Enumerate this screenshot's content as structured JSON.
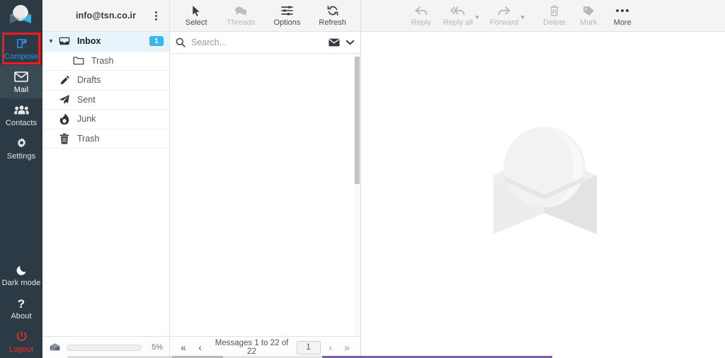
{
  "app": {
    "name": "Roundcube Webmail",
    "logo_icon": "roundcube-cube-logo"
  },
  "taskbar": {
    "items": [
      {
        "label": "Compose",
        "icon": "compose-pencil-square-icon",
        "state": "highlighted",
        "color": "#2c96e8",
        "highlight_color": "#ee1d1d"
      },
      {
        "label": "Mail",
        "icon": "envelope-icon",
        "state": "active"
      },
      {
        "label": "Contacts",
        "icon": "users-group-icon",
        "state": "normal"
      },
      {
        "label": "Settings",
        "icon": "gear-icon",
        "state": "normal"
      }
    ],
    "bottom_items": [
      {
        "label": "Dark mode",
        "icon": "moon-icon",
        "state": "normal"
      },
      {
        "label": "About",
        "icon": "question-mark-icon",
        "state": "normal"
      },
      {
        "label": "Logout",
        "icon": "power-off-icon",
        "state": "normal",
        "color": "#e03b35"
      }
    ],
    "background_color": "#2b3a44"
  },
  "folders": {
    "account": {
      "email": "info@tsn.co.ir",
      "menu_icon": "kebab-menu-icon"
    },
    "items": [
      {
        "name": "Inbox",
        "icon": "inbox-icon",
        "selected": true,
        "expanded": true,
        "child": false,
        "badge": "1",
        "chevron": "chevron-down-icon"
      },
      {
        "name": "Trash",
        "icon": "folder-icon",
        "selected": false,
        "child": true,
        "badge": ""
      },
      {
        "name": "Drafts",
        "icon": "pencil-icon",
        "selected": false,
        "child": false,
        "badge": ""
      },
      {
        "name": "Sent",
        "icon": "paper-plane-icon",
        "selected": false,
        "child": false,
        "badge": ""
      },
      {
        "name": "Junk",
        "icon": "fire-icon",
        "selected": false,
        "child": false,
        "badge": ""
      },
      {
        "name": "Trash",
        "icon": "trash-can-icon",
        "selected": false,
        "child": false,
        "badge": ""
      }
    ],
    "quota": {
      "icon": "database-disk-icon",
      "percent_label": "5%",
      "percent_value": 5,
      "fill_color": "#39b5f0"
    }
  },
  "list_toolbar": {
    "buttons": [
      {
        "label": "Select",
        "icon": "cursor-arrow-icon",
        "disabled": false
      },
      {
        "label": "Threads",
        "icon": "speech-bubbles-icon",
        "disabled": true
      },
      {
        "label": "Options",
        "icon": "sliders-options-icon",
        "disabled": false
      },
      {
        "label": "Refresh",
        "icon": "refresh-arrows-icon",
        "disabled": false
      }
    ]
  },
  "search": {
    "placeholder": "Search...",
    "value": "",
    "icon": "search-magnifier-icon",
    "scope_icon": "envelope-icon",
    "dropdown_icon": "chevron-down-icon"
  },
  "message_list": {
    "rows": [],
    "empty": true,
    "scrollbar": {
      "visible": true
    }
  },
  "pager": {
    "first_icon": "double-chevron-left-icon",
    "prev_icon": "chevron-left-icon",
    "count_label": "Messages 1 to 22 of 22",
    "page_value": "1",
    "next_icon": "chevron-right-icon",
    "last_icon": "double-chevron-right-icon"
  },
  "content_toolbar": {
    "buttons": [
      {
        "label": "Reply",
        "icon": "reply-arrow-icon",
        "disabled": true,
        "has_caret": false
      },
      {
        "label": "Reply all",
        "icon": "reply-all-arrows-icon",
        "disabled": true,
        "has_caret": true
      },
      {
        "label": "Forward",
        "icon": "forward-arrow-icon",
        "disabled": true,
        "has_caret": true
      },
      {
        "label": "Delete",
        "icon": "trash-can-icon",
        "disabled": true,
        "has_caret": false
      },
      {
        "label": "Mark",
        "icon": "tag-label-icon",
        "disabled": true,
        "has_caret": false
      },
      {
        "label": "More",
        "icon": "ellipsis-horizontal-icon",
        "disabled": false,
        "has_caret": false
      }
    ]
  },
  "content": {
    "watermark_icon": "roundcube-cube-watermark",
    "message": ""
  }
}
